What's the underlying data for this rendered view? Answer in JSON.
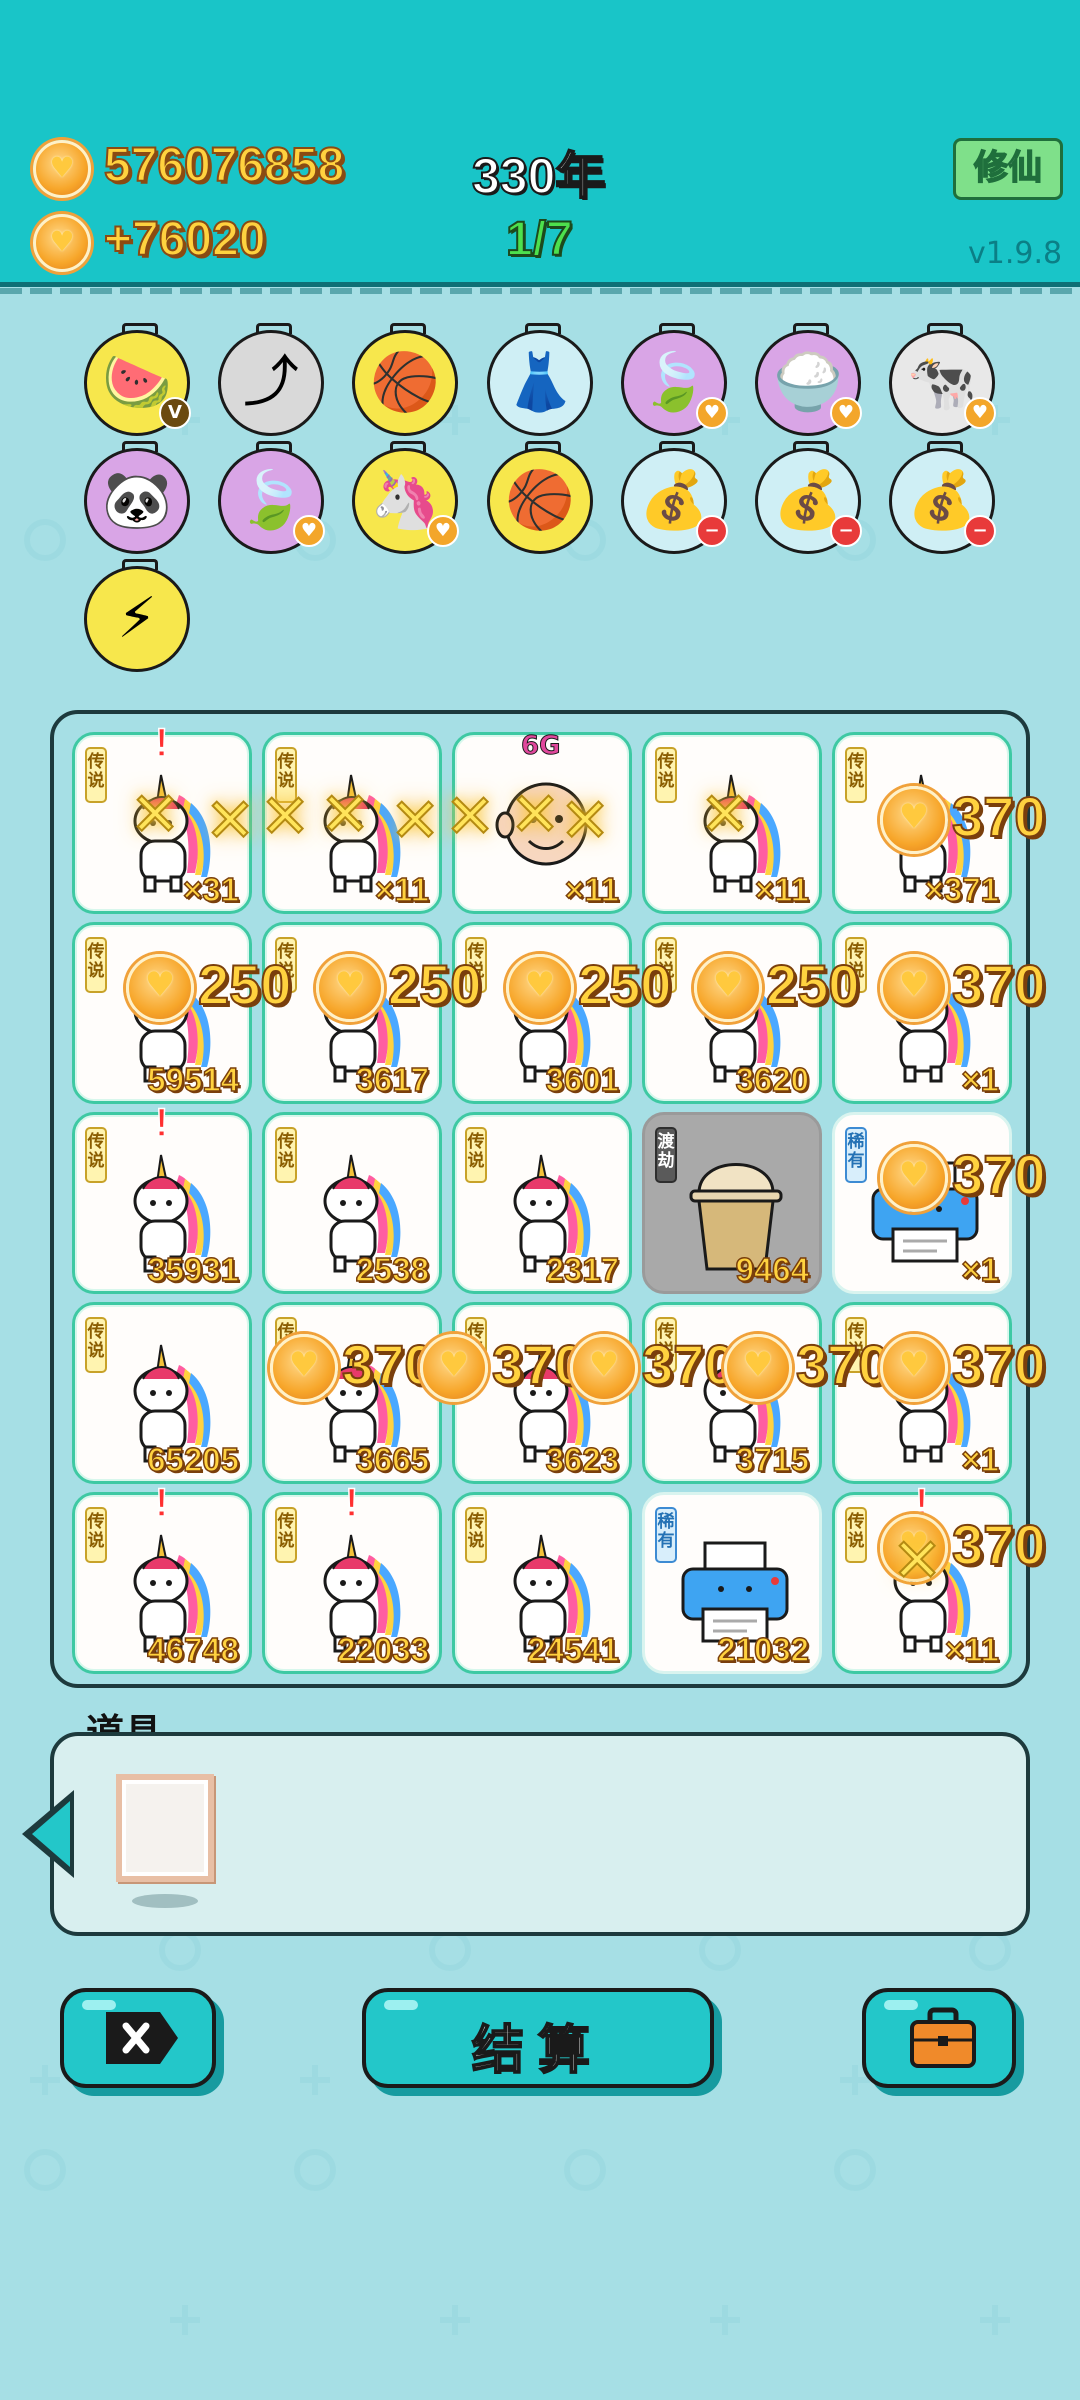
{
  "header": {
    "coins_total": "576076858",
    "coins_rate": "+76020",
    "years": "330年",
    "progress": "1/7",
    "xiuxian_label": "修仙",
    "version": "v1.9.8"
  },
  "skills": [
    {
      "icon": "fruit-plate-icon",
      "glyph": "🍉",
      "bg": "#f7e74c",
      "badge": "V",
      "badge_color": "#6b4a10"
    },
    {
      "icon": "upgrade-arrow-icon",
      "glyph": "⤴",
      "bg": "#d9d9d9",
      "badge": "",
      "badge_color": ""
    },
    {
      "icon": "basketballs-icon",
      "glyph": "🏀",
      "bg": "#f7e74c",
      "badge": "",
      "badge_color": ""
    },
    {
      "icon": "skirt-icon",
      "glyph": "👗",
      "bg": "#cfeff5",
      "badge": "",
      "badge_color": ""
    },
    {
      "icon": "leaf-icon",
      "glyph": "🍃",
      "bg": "#d9a5e6",
      "badge": "♥",
      "badge_color": "#f3a62a"
    },
    {
      "icon": "rice-bowl-icon",
      "glyph": "🍚",
      "bg": "#d9a5e6",
      "badge": "♥",
      "badge_color": "#f3a62a"
    },
    {
      "icon": "cows-icon",
      "glyph": "🐄",
      "bg": "#e8e8e8",
      "badge": "♥",
      "badge_color": "#f3a62a"
    },
    {
      "icon": "panda-icon",
      "glyph": "🐼",
      "bg": "#d9a5e6",
      "badge": "",
      "badge_color": ""
    },
    {
      "icon": "leaf-icon",
      "glyph": "🍃",
      "bg": "#d9a5e6",
      "badge": "♥",
      "badge_color": "#f3a62a"
    },
    {
      "icon": "unicorn-icon",
      "glyph": "🦄",
      "bg": "#f7e74c",
      "badge": "♥",
      "badge_color": "#f3a62a"
    },
    {
      "icon": "basketballs-icon",
      "glyph": "🏀",
      "bg": "#f7e74c",
      "badge": "",
      "badge_color": ""
    },
    {
      "icon": "money-bag-icon",
      "glyph": "💰",
      "bg": "#cfeff5",
      "badge": "−",
      "badge_color": "#e83a3a"
    },
    {
      "icon": "money-bag-icon",
      "glyph": "💰",
      "bg": "#cfeff5",
      "badge": "−",
      "badge_color": "#e83a3a"
    },
    {
      "icon": "money-bag-icon",
      "glyph": "💰",
      "bg": "#cfeff5",
      "badge": "−",
      "badge_color": "#e83a3a"
    },
    {
      "icon": "lightning-icon",
      "glyph": "⚡",
      "bg": "#f7e74c",
      "badge": "",
      "badge_color": ""
    }
  ],
  "grid": [
    {
      "tag": "传说",
      "tag_type": "legend",
      "item": "unicorn-icon",
      "count": "×31",
      "exclaim": "!"
    },
    {
      "tag": "传说",
      "tag_type": "legend",
      "item": "unicorn-icon",
      "count": "×11",
      "exclaim": ""
    },
    {
      "tag": "",
      "tag_type": "none",
      "item": "grandpa-icon",
      "count": "×11",
      "exclaim": "",
      "label_top": "6G"
    },
    {
      "tag": "传说",
      "tag_type": "legend",
      "item": "unicorn-icon",
      "count": "×11",
      "exclaim": ""
    },
    {
      "tag": "传说",
      "tag_type": "legend",
      "item": "unicorn-icon",
      "count": "×371",
      "exclaim": ""
    },
    {
      "tag": "传说",
      "tag_type": "legend",
      "item": "unicorn-icon",
      "count": "59514",
      "exclaim": ""
    },
    {
      "tag": "传说",
      "tag_type": "legend",
      "item": "unicorn-icon",
      "count": "3617",
      "exclaim": ""
    },
    {
      "tag": "传说",
      "tag_type": "legend",
      "item": "unicorn-icon",
      "count": "3601",
      "exclaim": ""
    },
    {
      "tag": "传说",
      "tag_type": "legend",
      "item": "unicorn-icon",
      "count": "3620",
      "exclaim": ""
    },
    {
      "tag": "传说",
      "tag_type": "legend",
      "item": "unicorn-icon",
      "count": "×1",
      "exclaim": ""
    },
    {
      "tag": "传说",
      "tag_type": "legend",
      "item": "unicorn-icon",
      "count": "35931",
      "exclaim": "!"
    },
    {
      "tag": "传说",
      "tag_type": "legend",
      "item": "unicorn-icon",
      "count": "2538",
      "exclaim": ""
    },
    {
      "tag": "传说",
      "tag_type": "legend",
      "item": "unicorn-icon",
      "count": "2317",
      "exclaim": ""
    },
    {
      "tag": "渡劫",
      "tag_type": "kalpa",
      "item": "bubble-tea-icon",
      "count": "9464",
      "exclaim": ""
    },
    {
      "tag": "稀有",
      "tag_type": "rare",
      "item": "printer-icon",
      "count": "×1",
      "exclaim": ""
    },
    {
      "tag": "传说",
      "tag_type": "legend",
      "item": "unicorn-icon",
      "count": "65205",
      "exclaim": ""
    },
    {
      "tag": "传说",
      "tag_type": "legend",
      "item": "unicorn-icon",
      "count": "3665",
      "exclaim": ""
    },
    {
      "tag": "传说",
      "tag_type": "legend",
      "item": "unicorn-icon",
      "count": "3623",
      "exclaim": ""
    },
    {
      "tag": "传说",
      "tag_type": "legend",
      "item": "unicorn-icon",
      "count": "3715",
      "exclaim": ""
    },
    {
      "tag": "传说",
      "tag_type": "legend",
      "item": "unicorn-icon",
      "count": "×1",
      "exclaim": ""
    },
    {
      "tag": "传说",
      "tag_type": "legend",
      "item": "unicorn-icon",
      "count": "46748",
      "exclaim": "!"
    },
    {
      "tag": "传说",
      "tag_type": "legend",
      "item": "unicorn-icon",
      "count": "22033",
      "exclaim": "!"
    },
    {
      "tag": "传说",
      "tag_type": "legend",
      "item": "unicorn-icon",
      "count": "24541",
      "exclaim": ""
    },
    {
      "tag": "稀有",
      "tag_type": "rare",
      "item": "printer-icon",
      "count": "21032",
      "exclaim": ""
    },
    {
      "tag": "传说",
      "tag_type": "legend",
      "item": "unicorn-icon",
      "count": "×11",
      "exclaim": "!"
    }
  ],
  "floating_rewards": [
    "370",
    "250",
    "250",
    "250",
    "250",
    "370",
    "370",
    "370",
    "370",
    "370",
    "370",
    "370",
    "370"
  ],
  "props": {
    "title": "道具",
    "items": [
      {
        "icon": "picture-frame-icon"
      }
    ]
  },
  "bottom": {
    "exit_icon": "exit-x-icon",
    "settle_label": "结算",
    "bag_icon": "briefcase-icon"
  }
}
